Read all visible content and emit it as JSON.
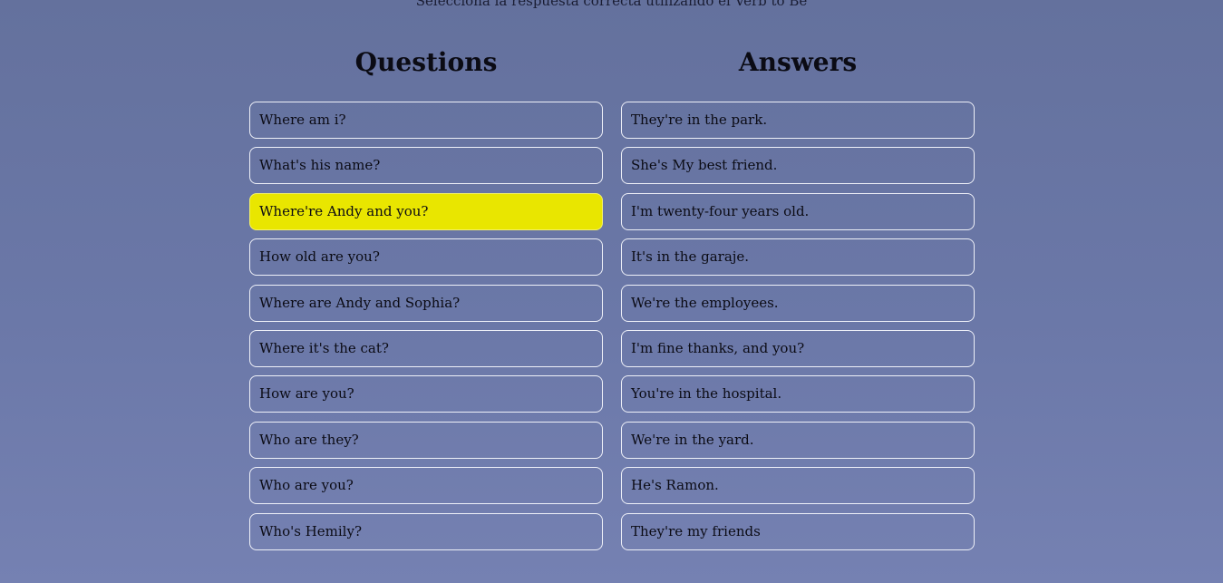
{
  "instruction": "Selecciona la respuesta correcta utilizando el Verb to Be",
  "questions": {
    "title": "Questions",
    "items": [
      "Where am i?",
      "What's his name?",
      "Where're Andy and you?",
      "How old are you?",
      "Where are Andy and Sophia?",
      "Where it's the cat?",
      "How are you?",
      "Who are they?",
      "Who are you?",
      "Who's Hemily?"
    ],
    "selected_index": 2
  },
  "answers": {
    "title": "Answers",
    "items": [
      "They're in the park.",
      "She's My best friend.",
      "I'm twenty-four years old.",
      "It's in the garaje.",
      "We're the employees.",
      "I'm fine thanks, and you?",
      "You're in the hospital.",
      "We're in the yard.",
      "He's Ramon.",
      "They're my friends"
    ]
  },
  "colors": {
    "selected_highlight": "#e9e600",
    "background": "#6b78a8"
  }
}
